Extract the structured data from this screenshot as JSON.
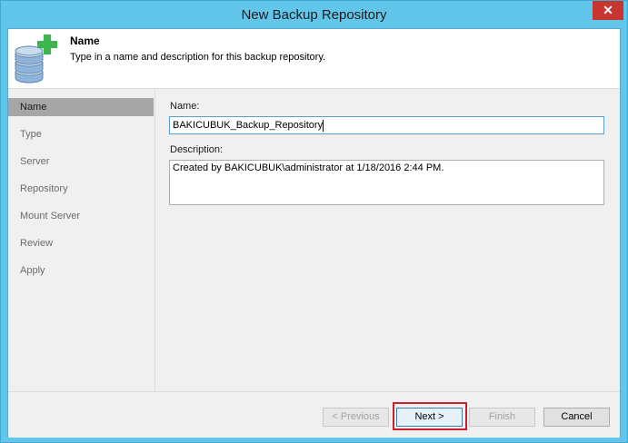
{
  "window": {
    "title": "New Backup Repository",
    "close_glyph": "✕"
  },
  "header": {
    "title": "Name",
    "description": "Type in a name and description for this backup repository.",
    "icon": "database-add-icon"
  },
  "nav": {
    "items": [
      {
        "label": "Name",
        "active": true
      },
      {
        "label": "Type",
        "active": false
      },
      {
        "label": "Server",
        "active": false
      },
      {
        "label": "Repository",
        "active": false
      },
      {
        "label": "Mount Server",
        "active": false
      },
      {
        "label": "Review",
        "active": false
      },
      {
        "label": "Apply",
        "active": false
      }
    ]
  },
  "form": {
    "name_label": "Name:",
    "name_value": "BAKICUBUK_Backup_Repository",
    "description_label": "Description:",
    "description_value": "Created by BAKICUBUK\\administrator at 1/18/2016 2:44 PM."
  },
  "footer": {
    "previous_label": "< Previous",
    "next_label": "Next >",
    "finish_label": "Finish",
    "cancel_label": "Cancel"
  },
  "colors": {
    "title_bar": "#62c6ea",
    "close_button": "#c7372f",
    "plus_icon": "#3cb54a",
    "highlight": "#cc1e2b",
    "nav_active": "#a6a6a6"
  }
}
